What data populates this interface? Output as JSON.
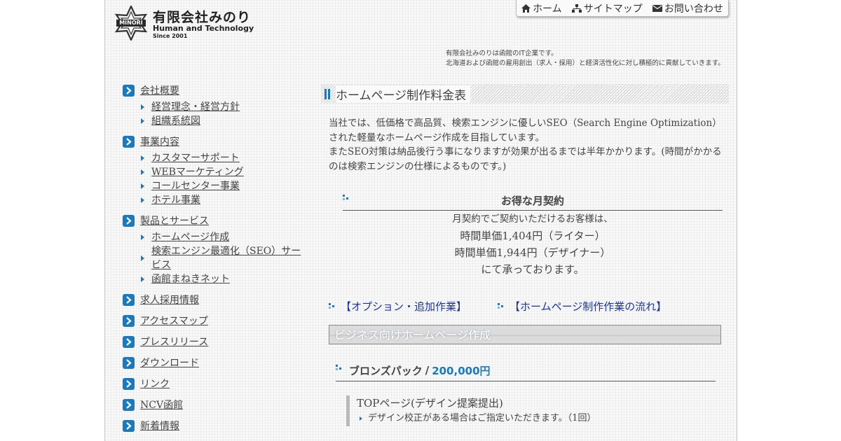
{
  "header": {
    "logo_badge_text": "MINORI",
    "company_name": "有限会社みのり",
    "company_subtitle": "Human and Technology",
    "since": "Since 2001"
  },
  "topnav": {
    "home": "ホーム",
    "sitemap": "サイトマップ",
    "contact": "お問い合わせ"
  },
  "tagline": {
    "line1": "有限会社みのりは函館のIT企業です。",
    "line2": "北海道および函館の雇用創出（求人・採用）と経済活性化に対し積極的に貢献していきます。"
  },
  "sidebar": {
    "items": [
      {
        "label": "会社概要",
        "subs": [
          "経営理念・経営方針",
          "組織系統図"
        ]
      },
      {
        "label": "事業内容",
        "subs": [
          "カスタマーサポート",
          "WEBマーケティング",
          "コールセンター事業",
          "ホテル事業"
        ]
      },
      {
        "label": "製品とサービス",
        "subs": [
          "ホームページ作成",
          "検索エンジン最適化（SEO）サービス",
          "函館まねきネット"
        ]
      },
      {
        "label": "求人採用情報",
        "subs": []
      },
      {
        "label": "アクセスマップ",
        "subs": []
      },
      {
        "label": "プレスリリース",
        "subs": []
      },
      {
        "label": "ダウンロード",
        "subs": []
      },
      {
        "label": "リンク",
        "subs": []
      },
      {
        "label": "NCV函館",
        "subs": []
      },
      {
        "label": "新着情報",
        "subs": []
      }
    ]
  },
  "main": {
    "page_title": "ホームページ制作料金表",
    "intro_1": "当社では、低価格で高品質、検索エンジンに優しいSEO（Search Engine Optimization）された軽量なホームページ作成を目指しています。",
    "intro_2": "またSEO対策は納品後行う事になりますが効果が出るまでは半年かかります。(時間がかかるのは検索エンジンの仕様によるものです。)",
    "plan": {
      "title": "お得な月契約",
      "lead": "月契約でご契約いただけるお客様は、",
      "writer_rate": "時間単価1,404円（ライター）",
      "designer_rate": "時間単価1,944円（デザイナー）",
      "closing": "にて承っております。"
    },
    "links": {
      "options": "【オプション・追加作業】",
      "flow": "【ホームページ制作作業の流れ】"
    },
    "banner": "ビジネス向けホームページ作成",
    "pack": {
      "name": "ブロンズパック",
      "separator": "/",
      "price": "200,000円",
      "detail_title": "TOPページ(デザイン提案提出)",
      "detail_note": "デザイン校正がある場合はご指定いただきます。（1回）"
    }
  },
  "colors": {
    "accent": "#1a7abf",
    "link": "#1b34a6",
    "text": "#444444"
  }
}
